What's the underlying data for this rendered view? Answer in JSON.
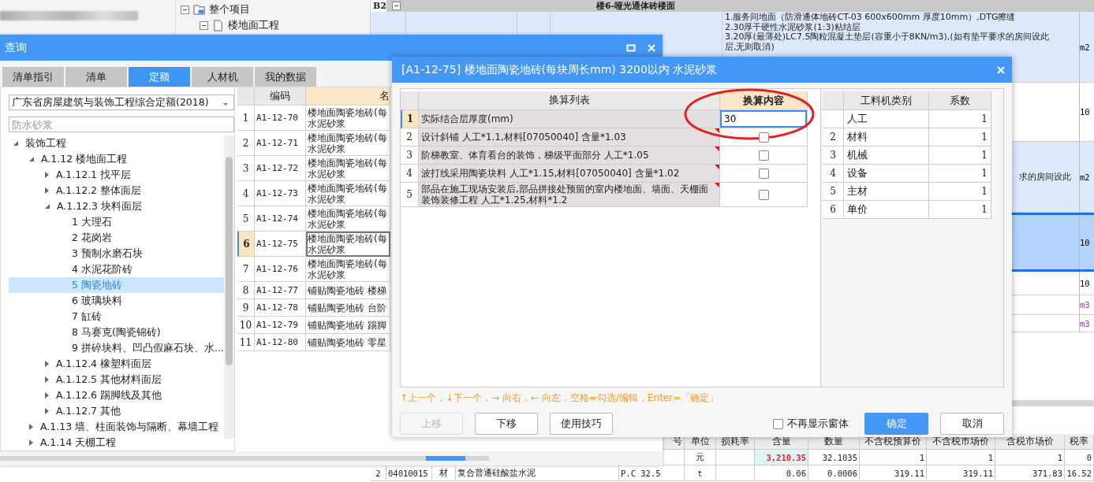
{
  "background": {
    "project_tree": [
      {
        "label": "整个项目",
        "kind": "project",
        "expanded": true
      },
      {
        "label": "楼地面工程",
        "kind": "unit",
        "expanded": true
      }
    ],
    "sheet": {
      "row_label": "B2",
      "group_title": "楼6-哑光通体砖楼面",
      "rows": [
        {
          "kind": "clause",
          "selected": false,
          "description": [
            "1.服务间地面（防滑通体地砖CT-03 600x600mm 厚度10mm）,DTG擦缝",
            "2.30厚干硬性水泥砂浆(1:3)粘结层",
            "3.20厚(最薄处)LC7.5陶粒混凝土垫层(容重小于8KN/m3),(如有垫平要求的房间设此",
            "层,无则取消)"
          ],
          "column_last": "m2",
          "color": "#000000"
        },
        {
          "kind": "quota",
          "selected": false,
          "column_last": "10",
          "color": "#000000"
        },
        {
          "kind": "clause",
          "selected": false,
          "description": [
            "求的房间设此"
          ],
          "column_last": "m2",
          "color": "#000000"
        },
        {
          "kind": "quota",
          "selected": true,
          "column_last": "10",
          "color": "#000000"
        },
        {
          "kind": "quota",
          "selected": false,
          "column_last": "10",
          "color": "#000000"
        },
        {
          "kind": "quota",
          "selected": false,
          "column_last": "m3",
          "color": "#9b30b0"
        },
        {
          "kind": "quota",
          "selected": false,
          "column_last": "m3",
          "color": "#9b30b0"
        }
      ]
    },
    "detail_table": {
      "columns": {
        "spec": "号",
        "unit": "单位",
        "loss_rate": "损耗率",
        "content": "含量",
        "quantity": "数量",
        "pretax_budget_price": "不含税预算价",
        "pretax_market_price": "不含税市场价",
        "market_price": "含税市场价",
        "tax_rate": "税率"
      },
      "rows": [
        {
          "unit": "元",
          "content": "3,210.35",
          "quantity": "32.1035",
          "pretax_budget_price": "1",
          "pretax_market_price": "1",
          "market_price": "1",
          "tax_rate": "0",
          "content_modified": true
        },
        {
          "number": "2",
          "code": "04010015",
          "type": "材",
          "name": "复合普通硅酸盐水泥",
          "spec": "P.C 32.5",
          "unit": "t",
          "content": "0.06",
          "quantity": "0.0006",
          "pretax_budget_price": "319.11",
          "pretax_market_price": "319.11",
          "market_price": "371.83",
          "tax_rate": "16.52",
          "content_modified": false
        }
      ]
    }
  },
  "query": {
    "title": "查询",
    "tabs": [
      {
        "label": "清单指引",
        "selected": false
      },
      {
        "label": "清单",
        "selected": false
      },
      {
        "label": "定额",
        "selected": true
      },
      {
        "label": "人材机",
        "selected": false
      },
      {
        "label": "我的数据",
        "selected": false
      }
    ],
    "library": "广东省房屋建筑与装饰工程综合定额(2018)",
    "search": {
      "placeholder": "防水砂浆"
    },
    "tree": [
      {
        "label": "装饰工程",
        "expanded": true,
        "selected": false,
        "children": [
          {
            "label": "A.1.12 楼地面工程",
            "expanded": true,
            "selected": false,
            "children": [
              {
                "label": "A.1.12.1 找平层",
                "expanded": false,
                "selected": false
              },
              {
                "label": "A.1.12.2 整体面层",
                "expanded": false,
                "selected": false
              },
              {
                "label": "A.1.12.3 块料面层",
                "expanded": true,
                "selected": false,
                "children": [
                  {
                    "label": "1 大理石",
                    "selected": false
                  },
                  {
                    "label": "2 花岗岩",
                    "selected": false
                  },
                  {
                    "label": "3 预制水磨石块",
                    "selected": false
                  },
                  {
                    "label": "4 水泥花阶砖",
                    "selected": false
                  },
                  {
                    "label": "5 陶瓷地砖",
                    "selected": true
                  },
                  {
                    "label": "6 玻璃块料",
                    "selected": false
                  },
                  {
                    "label": "7 缸砖",
                    "selected": false
                  },
                  {
                    "label": "8 马赛克(陶瓷锦砖)",
                    "selected": false
                  },
                  {
                    "label": "9 拼碎块料、凹凸假麻石块、水...",
                    "selected": false
                  }
                ]
              },
              {
                "label": "A.1.12.4 橡塑料面层",
                "expanded": false,
                "selected": false
              },
              {
                "label": "A.1.12.5 其他材料面层",
                "expanded": false,
                "selected": false
              },
              {
                "label": "A.1.12.6 踢脚线及其他",
                "expanded": false,
                "selected": false
              },
              {
                "label": "A.1.12.7 其他",
                "expanded": false,
                "selected": false
              }
            ]
          },
          {
            "label": "A.1.13 墙、柱面装饰与隔断、幕墙工程",
            "expanded": false,
            "selected": false
          },
          {
            "label": "A.1.14 天棚工程",
            "expanded": false,
            "selected": false
          }
        ]
      }
    ],
    "grid": {
      "columns": [
        "编码",
        "名"
      ],
      "rows": [
        {
          "number": "1",
          "code": "A1-12-70",
          "name": [
            "楼地面陶瓷地砖(每",
            "水泥砂浆"
          ],
          "selected": false
        },
        {
          "number": "2",
          "code": "A1-12-71",
          "name": [
            "楼地面陶瓷地砖(每",
            "水泥砂浆"
          ],
          "selected": false
        },
        {
          "number": "3",
          "code": "A1-12-72",
          "name": [
            "楼地面陶瓷地砖(每",
            "水泥砂浆"
          ],
          "selected": false
        },
        {
          "number": "4",
          "code": "A1-12-73",
          "name": [
            "楼地面陶瓷地砖(每",
            "水泥砂浆"
          ],
          "selected": false
        },
        {
          "number": "5",
          "code": "A1-12-74",
          "name": [
            "楼地面陶瓷地砖(每",
            "水泥砂浆"
          ],
          "selected": false
        },
        {
          "number": "6",
          "code": "A1-12-75",
          "name": [
            "楼地面陶瓷地砖(每",
            "水泥砂浆"
          ],
          "selected": true
        },
        {
          "number": "7",
          "code": "A1-12-76",
          "name": [
            "楼地面陶瓷地砖(每",
            "水泥砂浆"
          ],
          "selected": false
        },
        {
          "number": "8",
          "code": "A1-12-77",
          "name": [
            "铺贴陶瓷地砖 楼梯"
          ],
          "selected": false
        },
        {
          "number": "9",
          "code": "A1-12-78",
          "name": [
            "铺贴陶瓷地砖 台阶"
          ],
          "selected": false
        },
        {
          "number": "10",
          "code": "A1-12-79",
          "name": [
            "铺贴陶瓷地砖 踢脚"
          ],
          "selected": false
        },
        {
          "number": "11",
          "code": "A1-12-80",
          "name": [
            "铺贴陶瓷地砖 零星"
          ],
          "selected": false
        }
      ]
    }
  },
  "dialog": {
    "title": "[A1-12-75] 楼地面陶瓷地砖(每块周长mm) 3200以内 水泥砂浆",
    "columns": [
      "换算列表",
      "换算内容"
    ],
    "rows": [
      {
        "number": "1",
        "label": "实际结合层厚度(mm)",
        "kind": "input",
        "value": "30",
        "selected": true,
        "has_note": false
      },
      {
        "number": "2",
        "label": "设计斜铺 人工*1.1,材料[07050040] 含量*1.03",
        "kind": "checkbox",
        "checked": false,
        "selected": false,
        "has_note": true
      },
      {
        "number": "3",
        "label": "阶梯教室、体育看台的装饰，梯级平面部分 人工*1.05",
        "kind": "checkbox",
        "checked": false,
        "selected": false,
        "has_note": true
      },
      {
        "number": "4",
        "label": "波打线采用陶瓷块料 人工*1.15,材料[07050040] 含量*1.02",
        "kind": "checkbox",
        "checked": false,
        "selected": false,
        "has_note": true
      },
      {
        "number": "5",
        "label": "部品在施工现场安装后,部品拼接处预留的室内楼地面、墙面、天棚面装饰装修工程 人工*1.25,材料*1.2",
        "kind": "checkbox",
        "checked": false,
        "selected": false,
        "has_note": true
      }
    ],
    "categories": {
      "columns": [
        "工料机类别",
        "系数"
      ],
      "rows": [
        {
          "name": "人工",
          "factor": "1"
        },
        {
          "number": "2",
          "name": "材料",
          "factor": "1"
        },
        {
          "number": "3",
          "name": "机械",
          "factor": "1"
        },
        {
          "number": "4",
          "name": "设备",
          "factor": "1"
        },
        {
          "number": "5",
          "name": "主材",
          "factor": "1"
        },
        {
          "number": "6",
          "name": "单价",
          "factor": "1"
        }
      ]
    },
    "hint": "↑上一个，↓下一个，→ 向右，← 向左，空格=勾选/编辑，Enter=「确定」",
    "buttons": [
      {
        "label": "上移",
        "disabled": true
      },
      {
        "label": "下移",
        "disabled": false
      },
      {
        "label": "使用技巧",
        "disabled": false
      }
    ],
    "dont_show_again": {
      "label": "不再显示窗体",
      "checked": false
    },
    "actions": [
      {
        "label": "确定",
        "kind": "primary"
      },
      {
        "label": "取消",
        "kind": "default"
      }
    ]
  },
  "annotations": [
    {
      "kind": "ellipse"
    }
  ]
}
